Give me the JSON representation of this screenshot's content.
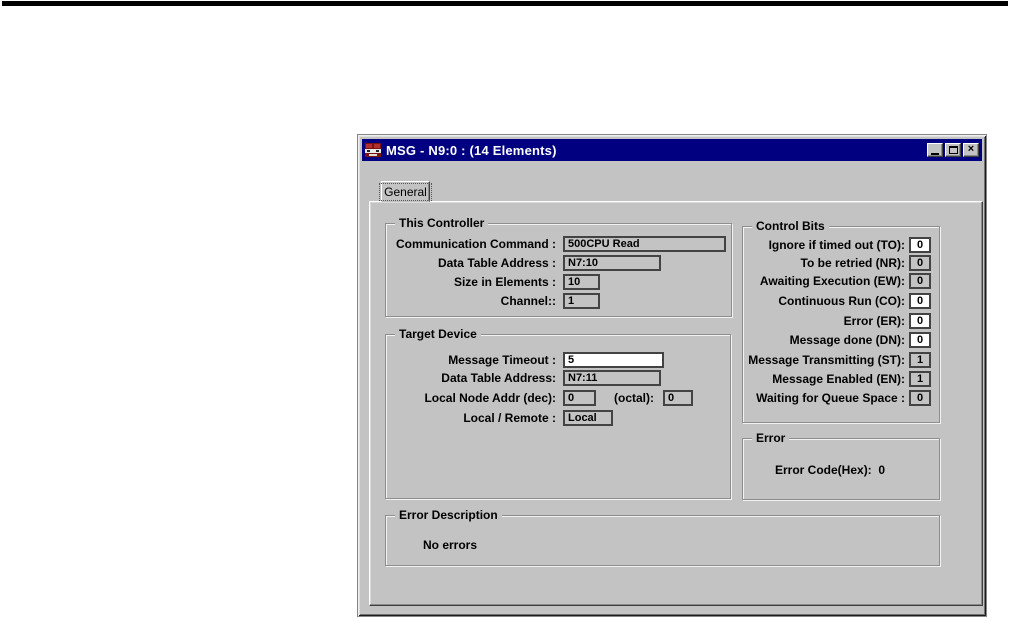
{
  "page": {
    "top_rule_color": "#000000",
    "background": "#ffffff"
  },
  "window": {
    "title": "MSG - N9:0 : (14 Elements)",
    "titlebar_color": "#000080",
    "face_color": "#c3c3c3",
    "icon": "msg-instruction-icon",
    "buttons": {
      "minimize": "",
      "maximize": "",
      "close": "×"
    }
  },
  "tabs": [
    {
      "label": "General",
      "active": true
    }
  ],
  "groups": {
    "this_controller": {
      "title": "This Controller",
      "fields": [
        {
          "label": "Communication Command :",
          "value": "500CPU Read",
          "editable": false
        },
        {
          "label": "Data Table Address :",
          "value": "N7:10",
          "editable": false
        },
        {
          "label": "Size in Elements :",
          "value": "10",
          "editable": false
        },
        {
          "label": "Channel::",
          "value": "1",
          "editable": false
        }
      ]
    },
    "target_device": {
      "title": "Target Device",
      "fields": [
        {
          "label": "Message Timeout :",
          "value": "5",
          "editable": true
        },
        {
          "label": "Data Table Address:",
          "value": "N7:11",
          "editable": false
        },
        {
          "label": "Local Node Addr (dec):",
          "value": "0",
          "editable": false
        },
        {
          "label": "Local / Remote :",
          "value": "Local",
          "editable": false
        }
      ],
      "octal_label": "(octal):",
      "octal_value": "0"
    },
    "control_bits": {
      "title": "Control Bits",
      "bits": [
        {
          "label": "Ignore if timed out (TO):",
          "value": "0",
          "editable": true
        },
        {
          "label": "To be retried (NR):",
          "value": "0",
          "editable": false
        },
        {
          "label": "Awaiting Execution (EW):",
          "value": "0",
          "editable": false
        },
        {
          "label": "Continuous Run (CO):",
          "value": "0",
          "editable": true
        },
        {
          "label": "Error (ER):",
          "value": "0",
          "editable": true
        },
        {
          "label": "Message done (DN):",
          "value": "0",
          "editable": true
        },
        {
          "label": "Message Transmitting (ST):",
          "value": "1",
          "editable": false
        },
        {
          "label": "Message Enabled (EN):",
          "value": "1",
          "editable": false
        },
        {
          "label": "Waiting for Queue Space :",
          "value": "0",
          "editable": false
        }
      ]
    },
    "error": {
      "title": "Error",
      "code_label": "Error Code(Hex):",
      "code_value": "0"
    },
    "error_description": {
      "title": "Error Description",
      "text": "No errors"
    }
  }
}
